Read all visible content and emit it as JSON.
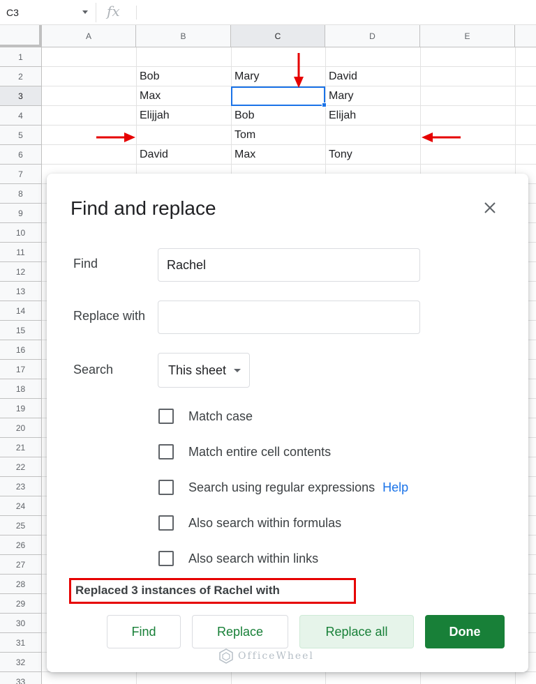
{
  "formula_bar": {
    "cell_reference": "C3",
    "fx_symbol": "fx"
  },
  "sheet": {
    "columns": [
      "A",
      "B",
      "C",
      "D",
      "E"
    ],
    "active_column": "C",
    "rows": [
      "1",
      "2",
      "3",
      "4",
      "5",
      "6",
      "7",
      "8",
      "9",
      "10",
      "11",
      "12",
      "13",
      "14",
      "15",
      "16",
      "17",
      "18",
      "19",
      "20",
      "21",
      "22",
      "23",
      "24",
      "25",
      "26",
      "27",
      "28",
      "29",
      "30",
      "31",
      "32",
      "33"
    ],
    "active_row": "3",
    "cells": {
      "B2": "Bob",
      "C2": "Mary",
      "D2": "David",
      "B3": "Max",
      "C3": "",
      "D3": "Mary",
      "B4": "Elijjah",
      "C4": "Bob",
      "D4": "Elijah",
      "B5": "",
      "C5": "Tom",
      "D5": "",
      "B6": "David",
      "C6": "Max",
      "D6": "Tony"
    },
    "annotation_color": "#e60000"
  },
  "dialog": {
    "title": "Find and replace",
    "find_label": "Find",
    "find_value": "Rachel",
    "replace_label": "Replace with",
    "replace_value": "",
    "search_label": "Search",
    "search_scope": "This sheet",
    "options": [
      {
        "label": "Match case",
        "checked": false
      },
      {
        "label": "Match entire cell contents",
        "checked": false
      },
      {
        "label": "Search using regular expressions",
        "checked": false
      },
      {
        "label": "Also search within formulas",
        "checked": false
      },
      {
        "label": "Also search within links",
        "checked": false
      }
    ],
    "help_link": "Help",
    "status_message": "Replaced 3 instances of Rachel with",
    "buttons": {
      "find": "Find",
      "replace": "Replace",
      "replace_all": "Replace all",
      "done": "Done"
    }
  },
  "watermark": "OfficeWheel",
  "colors": {
    "accent_green": "#188038",
    "selection_blue": "#1a73e8",
    "link_blue": "#1a73e8",
    "highlight_red": "#e60000"
  }
}
